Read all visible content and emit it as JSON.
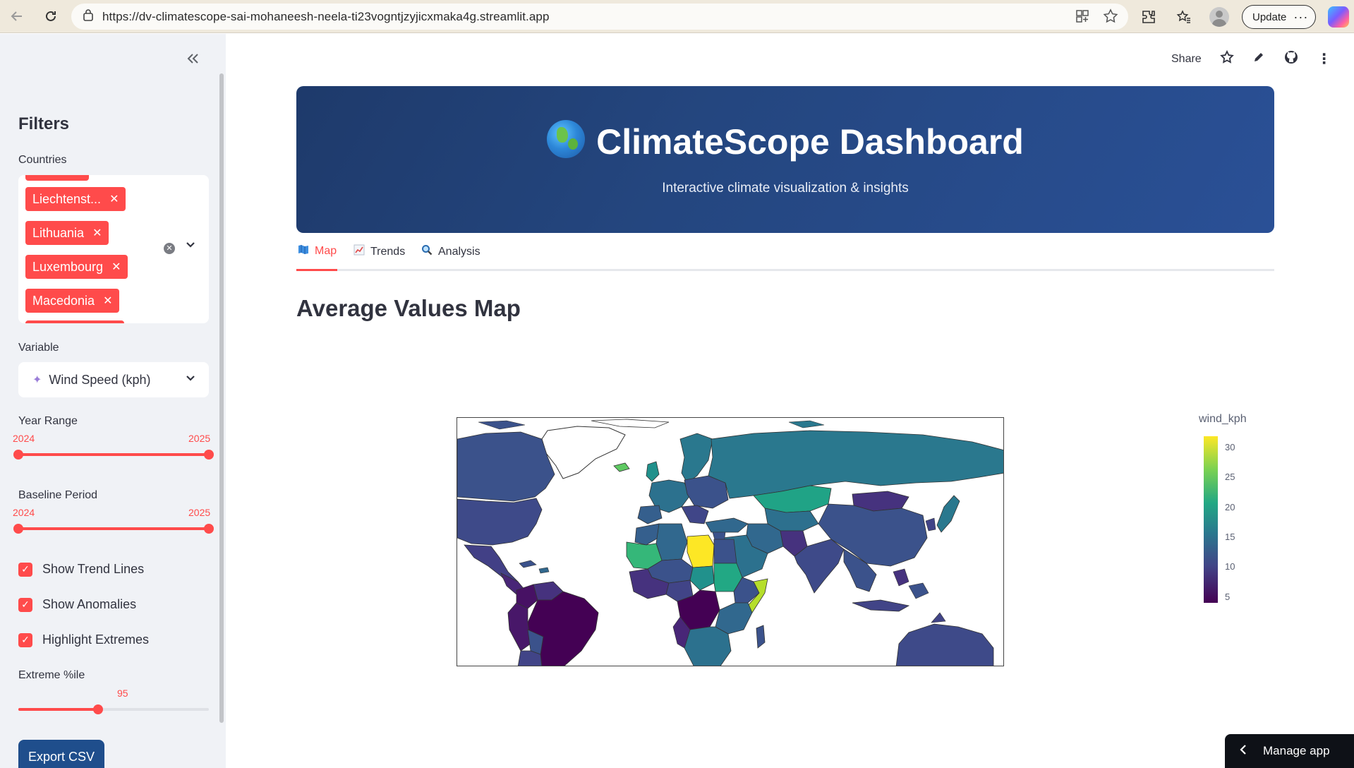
{
  "browser": {
    "url": "https://dv-climatescope-sai-mohaneesh-neela-ti23vogntjzyjicxmaka4g.streamlit.app",
    "update_label": "Update"
  },
  "sidebar": {
    "title": "Filters",
    "countries_label": "Countries",
    "selected_countries": [
      "Liechtenst...",
      "Lithuania",
      "Luxembourg",
      "Macedonia"
    ],
    "variable_label": "Variable",
    "variable_value": "Wind Speed (kph)",
    "year_range_label": "Year Range",
    "year_range": {
      "min": "2024",
      "max": "2025"
    },
    "baseline_label": "Baseline Period",
    "baseline": {
      "min": "2024",
      "max": "2025"
    },
    "checkboxes": [
      {
        "label": "Show Trend Lines",
        "checked": true
      },
      {
        "label": "Show Anomalies",
        "checked": true
      },
      {
        "label": "Highlight Extremes",
        "checked": true
      }
    ],
    "extreme_label": "Extreme %ile",
    "extreme_value": "95",
    "extreme_fraction": 0.95,
    "export_label": "Export CSV"
  },
  "header": {
    "share_label": "Share"
  },
  "banner": {
    "title": "ClimateScope Dashboard",
    "subtitle": "Interactive climate visualization & insights"
  },
  "tabs": [
    {
      "label": "Map",
      "active": true
    },
    {
      "label": "Trends",
      "active": false
    },
    {
      "label": "Analysis",
      "active": false
    }
  ],
  "section_title": "Average Values Map",
  "map": {
    "colorbar_title": "wind_kph",
    "colorbar_ticks": [
      "30",
      "25",
      "20",
      "15",
      "10",
      "5"
    ],
    "colors": {
      "high": "#fde725",
      "mid": "#21918c",
      "low": "#440154"
    }
  },
  "manage_label": "Manage app",
  "colors": {
    "accent": "#ff4b4b",
    "banner": "#24467f",
    "button": "#1f4e8c"
  }
}
